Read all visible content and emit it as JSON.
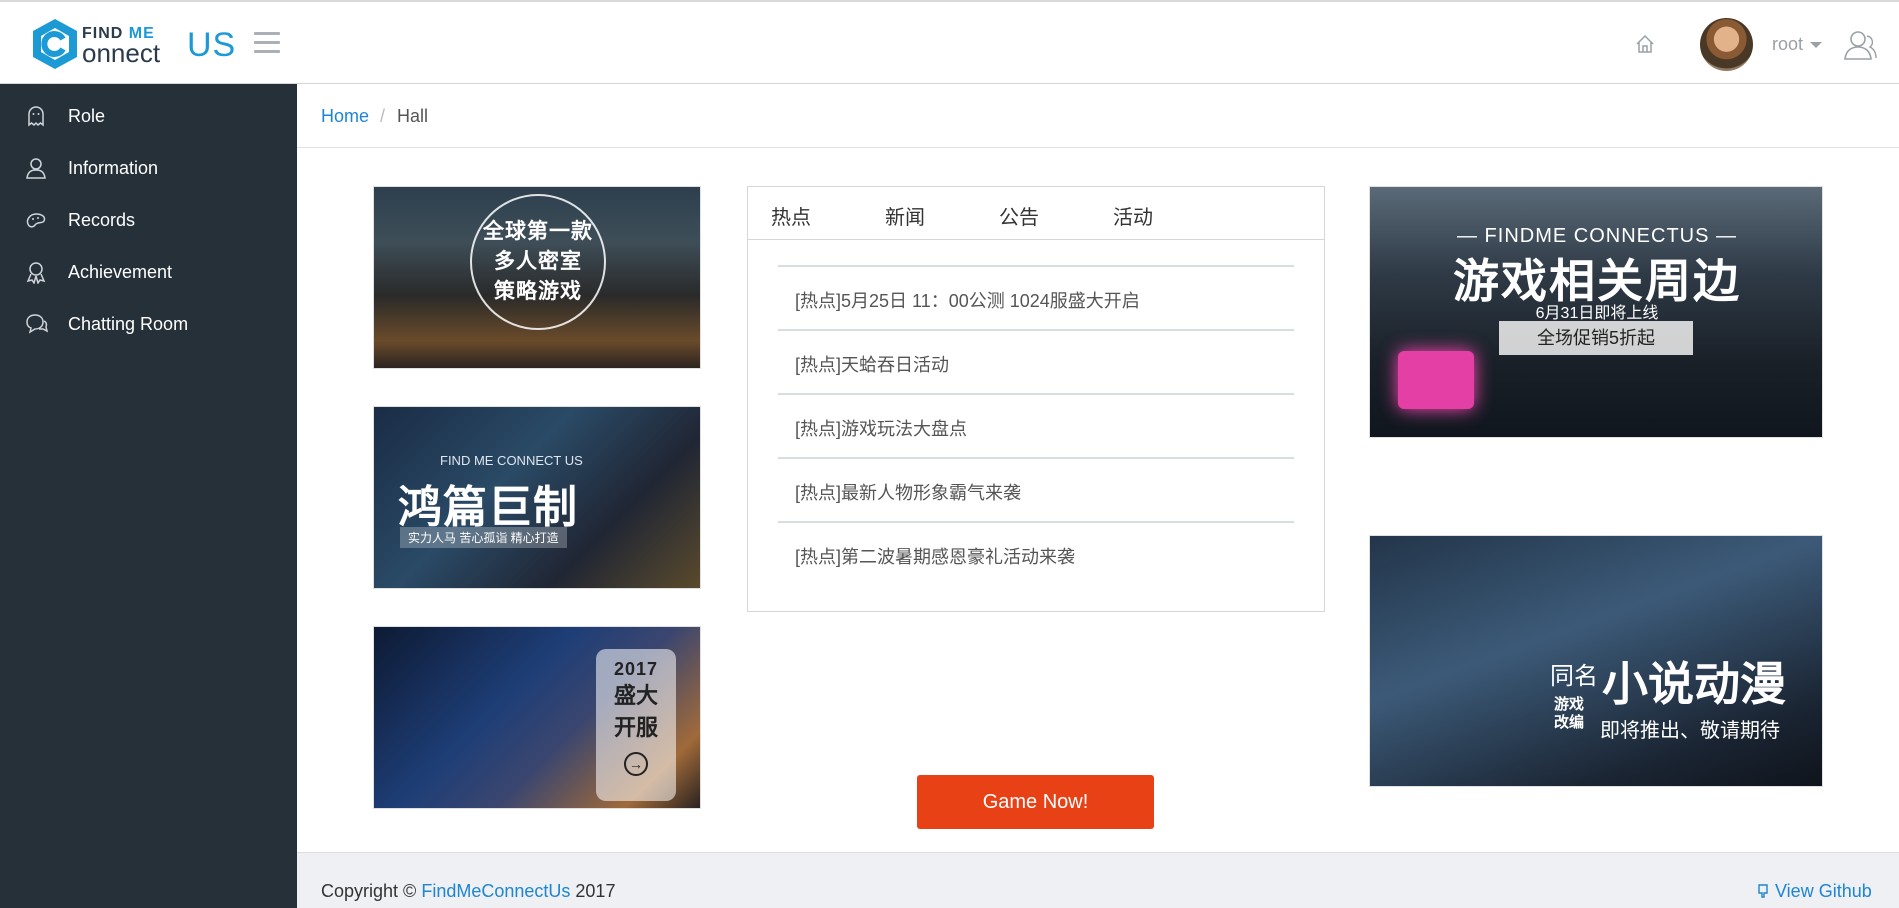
{
  "header": {
    "logo": {
      "find": "FIND",
      "me": "ME",
      "connect": "onnect",
      "us": "US"
    },
    "user_name": "root",
    "icons": {
      "menu": "hamburger-icon",
      "home": "home-icon",
      "profile": "user-icon"
    }
  },
  "sidebar": {
    "items": [
      {
        "label": "Role",
        "icon": "ghost-icon"
      },
      {
        "label": "Information",
        "icon": "user-icon"
      },
      {
        "label": "Records",
        "icon": "gamepad-icon"
      },
      {
        "label": "Achievement",
        "icon": "award-icon"
      },
      {
        "label": "Chatting Room",
        "icon": "chat-icon"
      }
    ]
  },
  "breadcrumb": {
    "home": "Home",
    "sep": "/",
    "current": "Hall"
  },
  "banners": {
    "b1": {
      "lines": [
        "全球第一款",
        "多人密室",
        "策略游戏"
      ]
    },
    "b2": {
      "en": "FIND ME CONNECT US",
      "big": "鸿篇巨制",
      "tag": "实力人马 苦心孤诣 精心打造"
    },
    "b3": {
      "year": "2017",
      "line1": "盛大",
      "line2": "开服"
    },
    "b4": {
      "en": "— FINDME CONNECTUS —",
      "big": "游戏相关周边",
      "date": "6月31日即将上线",
      "promo": "全场促销5折起"
    },
    "b5": {
      "tm": "同名",
      "big": "小说动漫",
      "side": "游戏改编",
      "sub": "即将推出、敬请期待"
    }
  },
  "news": {
    "tabs": [
      "热点",
      "新闻",
      "公告",
      "活动"
    ],
    "items": [
      "[热点]5月25日 11：00公测 1024服盛大开启",
      "[热点]天蛤吞日活动",
      "[热点]游戏玩法大盘点",
      "[热点]最新人物形象霸气来袭",
      "[热点]第二波暑期感恩豪礼活动来袭"
    ]
  },
  "cta": {
    "label": "Game Now!"
  },
  "footer": {
    "copyright": "Copyright ©",
    "brand": "FindMeConnectUs",
    "year": "2017",
    "github": "View Github"
  },
  "colors": {
    "sidebar": "#253038",
    "accent": "#1d85d3",
    "cta": "#e94116",
    "logo_blue": "#1c9ad6"
  }
}
